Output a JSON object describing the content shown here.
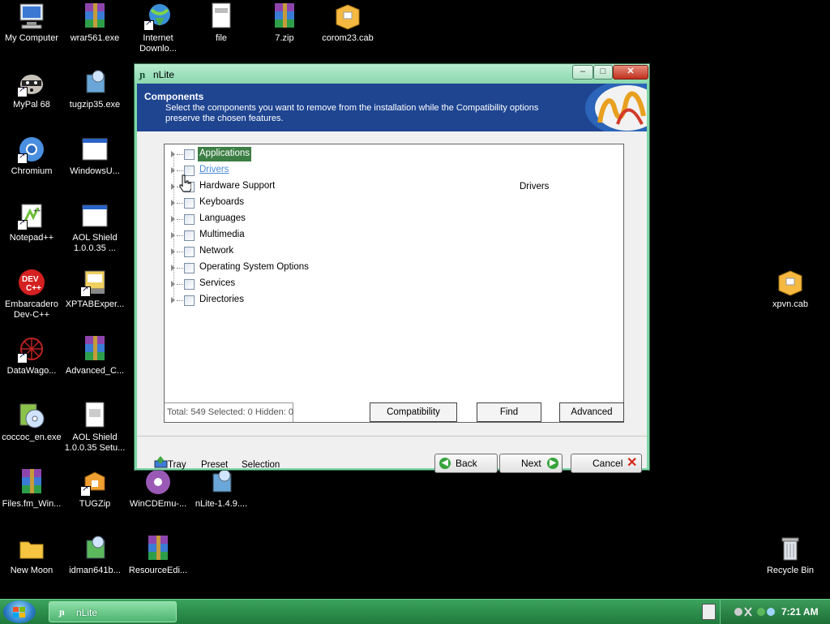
{
  "desktop": {
    "icons": [
      {
        "label": "My Computer"
      },
      {
        "label": "wrar561.exe"
      },
      {
        "label": "Internet\nDownlo..."
      },
      {
        "label": "file"
      },
      {
        "label": "7.zip"
      },
      {
        "label": "corom23.cab"
      },
      {
        "label": "MyPal 68"
      },
      {
        "label": "tugzip35.exe"
      },
      {
        "label": "Chromium"
      },
      {
        "label": "WindowsU..."
      },
      {
        "label": "Notepad++"
      },
      {
        "label": "AOL Shield\n1.0.0.35 ..."
      },
      {
        "label": "Embarcadero\nDev-C++"
      },
      {
        "label": "XPTABExper..."
      },
      {
        "label": "DataWago..."
      },
      {
        "label": "Advanced_C..."
      },
      {
        "label": "coccoc_en.exe"
      },
      {
        "label": "AOL Shield\n1.0.0.35 Setu..."
      },
      {
        "label": "Files.fm_Win..."
      },
      {
        "label": "TUGZip"
      },
      {
        "label": "WinCDEmu-..."
      },
      {
        "label": "nLite-1.4.9...."
      },
      {
        "label": "New Moon"
      },
      {
        "label": "idman641b..."
      },
      {
        "label": "ResourceEdi..."
      },
      {
        "label": "xpvn.cab"
      },
      {
        "label": "Recycle Bin"
      }
    ]
  },
  "window": {
    "title": "nLite",
    "header": {
      "title": "Components",
      "description": "Select the components you want to remove from the installation while the Compatibility options\npreserve the chosen features."
    },
    "tree": [
      {
        "label": "Applications"
      },
      {
        "label": "Drivers"
      },
      {
        "label": "Hardware Support"
      },
      {
        "label": "Keyboards"
      },
      {
        "label": "Languages"
      },
      {
        "label": "Multimedia"
      },
      {
        "label": "Network"
      },
      {
        "label": "Operating System Options"
      },
      {
        "label": "Services"
      },
      {
        "label": "Directories"
      }
    ],
    "detail": "Drivers",
    "status": "Total: 549 Selected: 0 Hidden: 0",
    "buttons": {
      "compatibility": "Compatibility",
      "find": "Find",
      "advanced": "Advanced"
    },
    "footer": {
      "tray": "Tray",
      "preset": "Preset",
      "selection": "Selection",
      "back": "Back",
      "next": "Next",
      "cancel": "Cancel"
    }
  },
  "taskbar": {
    "task_label": "nLite",
    "clock": "7:21 AM"
  },
  "colors": {
    "header_bg": "#1f4591",
    "selected_item": "#3c7f45",
    "window_frame": "#7fd6a6",
    "taskbar": "#2a8c4a"
  }
}
